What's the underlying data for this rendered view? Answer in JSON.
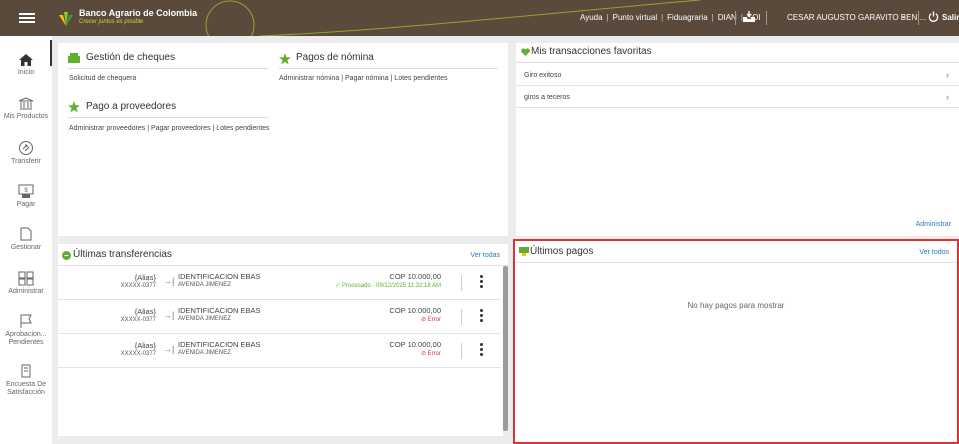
{
  "header": {
    "brand": "Banco Agrario de Colombia",
    "slogan": "Crecer juntos es posible",
    "links": [
      "Ayuda",
      "Punto virtual",
      "Fiduagraria",
      "DIAN",
      "SOI"
    ],
    "user": "CESAR AUGUSTO GARAVITO BENI...",
    "logout": "Salir"
  },
  "sidebar": {
    "items": [
      {
        "label": "Inicio",
        "icon": "home-icon"
      },
      {
        "label": "Mis Productos",
        "icon": "bank-icon"
      },
      {
        "label": "Transferir",
        "icon": "transfer-icon"
      },
      {
        "label": "Pagar",
        "icon": "pay-icon"
      },
      {
        "label": "Gestionar",
        "icon": "manage-icon"
      },
      {
        "label": "Administrar",
        "icon": "admin-icon"
      },
      {
        "label": "Aprobacion... Pendientes",
        "icon": "flag-icon"
      },
      {
        "label": "Encuesta De Satisfacción",
        "icon": "survey-icon"
      }
    ]
  },
  "shortcuts": {
    "cheques": {
      "title": "Gestión de cheques",
      "links": "Solicitud de chequera"
    },
    "nomina": {
      "title": "Pagos de nómina",
      "links": "Administrar nómina | Pagar nómina | Lotes pendientes"
    },
    "proveedores": {
      "title": "Pago a proveedores",
      "links": "Administrar proveedores | Pagar proveedores | Lotes pendientes"
    }
  },
  "favorites": {
    "title": "Mis transacciones favoritas",
    "items": [
      "Giro exitoso",
      "giros a teceros"
    ],
    "admin_link": "Administrar"
  },
  "transfers": {
    "title": "Últimas transferencias",
    "see_all": "Ver todas",
    "rows": [
      {
        "alias": "{Alias}",
        "account": "XXXXX-0377",
        "dest": "IDENTIFICACION EBAS",
        "name": "AVENIDA JIMENEZ",
        "amount": "COP 10.000,00",
        "status": "Procesado - 09/12/2025 11:32:18 AM",
        "state": "ok"
      },
      {
        "alias": "{Alias}",
        "account": "XXXXX-0377",
        "dest": "IDENTIFICACION EBAS",
        "name": "AVENIDA JIMENEZ",
        "amount": "COP 10.000,00",
        "status": "Error",
        "state": "err"
      },
      {
        "alias": "{Alias}",
        "account": "XXXXX-0377",
        "dest": "IDENTIFICACION EBAS",
        "name": "AVENIDA JIMENEZ",
        "amount": "COP 10.000,00",
        "status": "Error",
        "state": "err"
      }
    ]
  },
  "payments": {
    "title": "Últimos pagos",
    "see_all": "Ver todos",
    "empty": "No hay pagos para mostrar"
  },
  "colors": {
    "header_bg": "#5a4a3c",
    "accent_green": "#5fb030",
    "link_blue": "#2a79c9",
    "highlight_red": "#d8343a"
  }
}
